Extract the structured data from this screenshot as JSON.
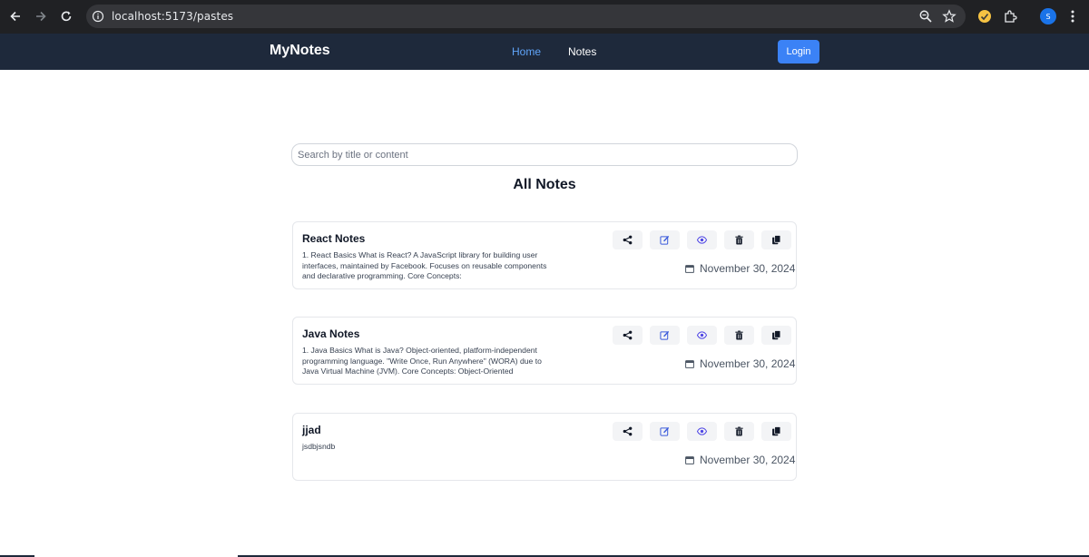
{
  "browser": {
    "url": "localhost:5173/pastes",
    "profile_initial": "S"
  },
  "navbar": {
    "brand": "MyNotes",
    "links": [
      "Home",
      "Notes"
    ],
    "login_label": "Login"
  },
  "search": {
    "placeholder": "Search by title or content"
  },
  "page_title": "All Notes",
  "notes": [
    {
      "title": "React Notes",
      "body": "1. React Basics What is React? A JavaScript library for building user interfaces, maintained by Facebook. Focuses on reusable components and declarative programming. Core Concepts:",
      "date": "November 30, 2024"
    },
    {
      "title": "Java Notes",
      "body": "1. Java Basics What is Java? Object-oriented, platform-independent programming language. \"Write Once, Run Anywhere\" (WORA) due to Java Virtual Machine (JVM). Core Concepts: Object-Oriented",
      "date": "November 30, 2024"
    },
    {
      "title": "jjad",
      "body": "jsdbjsndb",
      "date": "November 30, 2024"
    }
  ],
  "icons": {
    "share": "share-icon",
    "edit": "edit-icon",
    "view": "eye-icon",
    "delete": "trash-icon",
    "copy": "copy-icon",
    "date": "calendar-icon"
  },
  "colors": {
    "navbar_bg": "#1e293b",
    "accent": "#3b82f6",
    "active_link": "#60a5fa",
    "edit_icon": "#3b5bdb",
    "view_icon": "#4f46e5"
  }
}
